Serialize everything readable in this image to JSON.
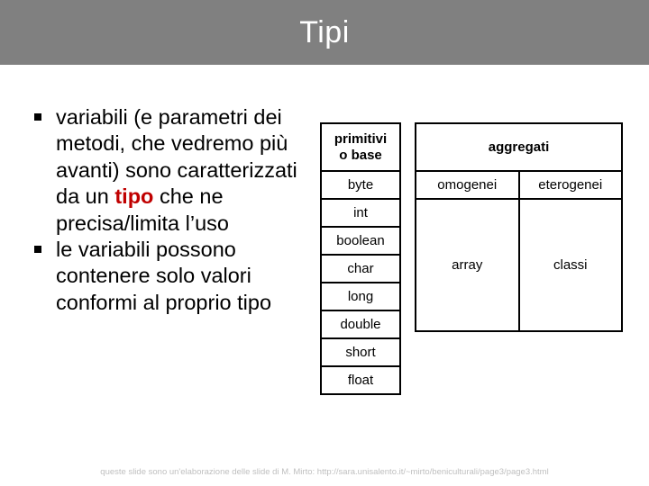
{
  "slide": {
    "title": "Tipi",
    "title_band_color": "#808080",
    "title_color": "#ffffff",
    "background_color": "#ffffff"
  },
  "bullets": [
    {
      "marker": "square-bullet",
      "segments": [
        {
          "text": "variabili (e parametri dei metodi, che vedremo più avanti) sono caratterizzati da un ",
          "style": "normal"
        },
        {
          "text": "tipo",
          "style": "bold-red"
        },
        {
          "text": " che ne precisa/limita l’uso",
          "style": "normal"
        }
      ]
    },
    {
      "marker": "square-bullet",
      "segments": [
        {
          "text": "le variabili possono contenere solo valori conformi al proprio tipo",
          "style": "normal"
        }
      ]
    }
  ],
  "accent": {
    "keyword_color": "#C00000",
    "keyword": "tipo"
  },
  "tables": {
    "primitive": {
      "header": "primitivi\no base",
      "header_line1": "primitivi",
      "header_line2": "o base",
      "rows": [
        "byte",
        "int",
        "boolean",
        "char",
        "long",
        "double",
        "short",
        "float"
      ]
    },
    "aggregate": {
      "header": "aggregati",
      "subheaders": [
        "omogenei",
        "eterogenei"
      ],
      "cells": [
        "array",
        "classi"
      ]
    }
  },
  "footer": {
    "note": "queste slide sono un'elaborazione delle slide di M. Mirto: http://sara.unisalento.it/~mirto/beniculturali/page3/page3.html"
  }
}
